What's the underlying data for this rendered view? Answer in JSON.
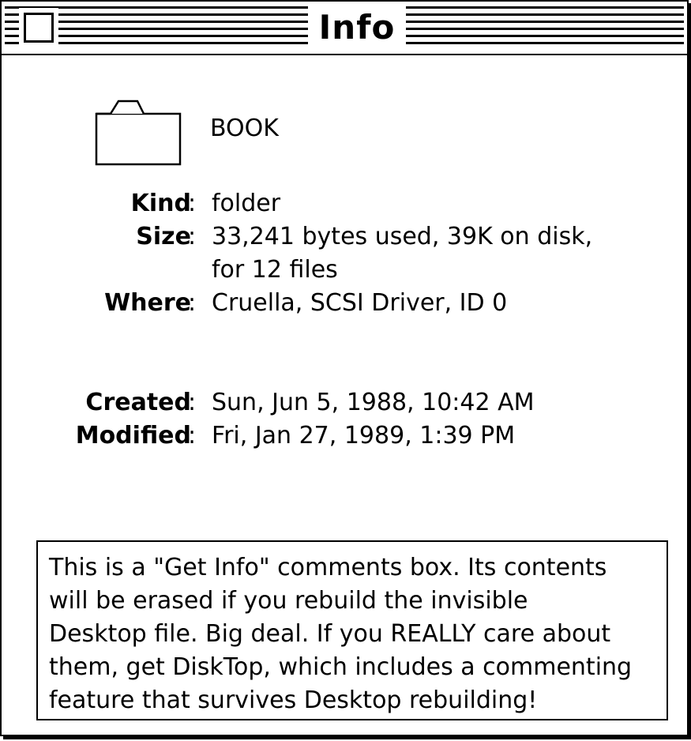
{
  "window": {
    "title": "Info"
  },
  "file": {
    "name": "BOOK",
    "icon": "folder-icon"
  },
  "info": {
    "kind_label": "Kind",
    "kind_value": "folder",
    "size_label": "Size",
    "size_value_line1": "33,241 bytes used, 39K on disk,",
    "size_value_line2": "for 12 files",
    "where_label": "Where",
    "where_value": "Cruella, SCSI Driver, ID 0",
    "created_label": "Created",
    "created_value": "Sun, Jun 5, 1988, 10:42 AM",
    "modified_label": "Modified",
    "modified_value": "Fri, Jan 27, 1989, 1:39 PM",
    "separator": ":"
  },
  "comments": {
    "text": "This is a \"Get Info\" comments box. Its contents\nwill be erased if you rebuild the invisible\nDesktop file. Big deal. If you REALLY care about\nthem, get DiskTop, which includes a commenting\nfeature that survives Desktop rebuilding!"
  }
}
